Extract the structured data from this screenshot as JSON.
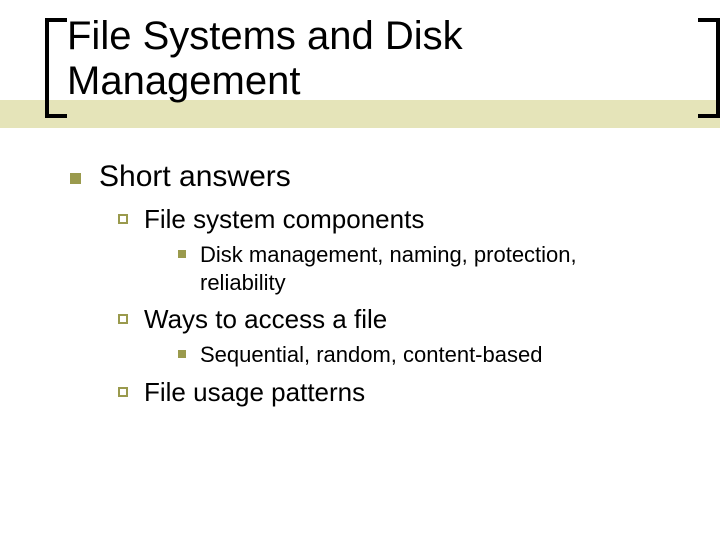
{
  "colors": {
    "accent": "#9a9a4d",
    "stripe": "#e5e4b9",
    "text": "#000000",
    "background": "#ffffff"
  },
  "title": "File Systems and Disk Management",
  "outline": {
    "lvl1": "Short answers",
    "items": [
      {
        "lvl2": "File system components",
        "lvl3": "Disk management, naming, protection, reliability"
      },
      {
        "lvl2": "Ways to access a file",
        "lvl3": "Sequential, random, content-based"
      },
      {
        "lvl2": "File usage patterns"
      }
    ]
  }
}
